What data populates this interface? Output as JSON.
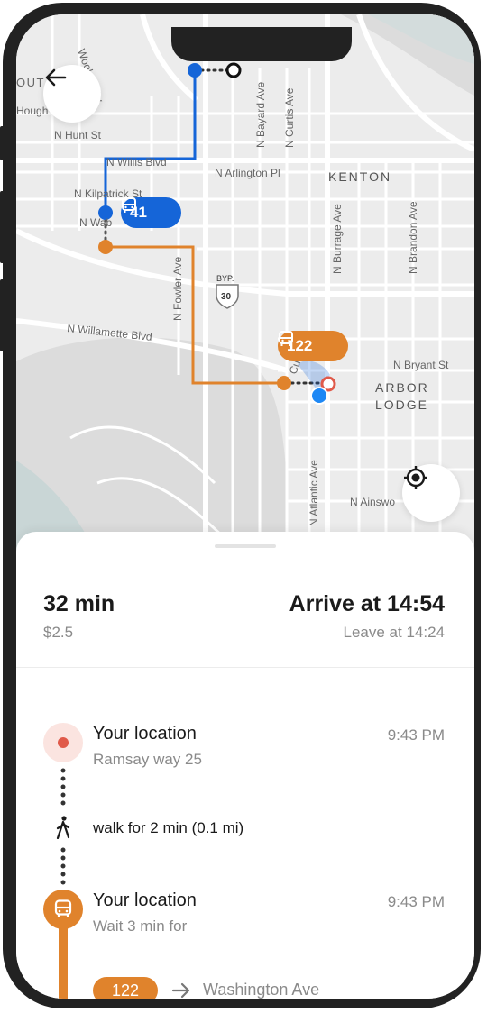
{
  "colors": {
    "bus_blue": "#1565d8",
    "bus_orange": "#e0832c",
    "map_bg": "#ececec",
    "text_primary": "#1a1a1a",
    "text_secondary": "#8a8a8a"
  },
  "map": {
    "street_labels": {
      "woolsey": "Woolsey Av",
      "out": "OUT",
      "hough": "Hough",
      "hunt": "N Hunt St",
      "willis": "N Willis Blvd",
      "arlington": "N Arlington Pl",
      "kenton": "KENTON",
      "bayard": "N Bayard Ave",
      "curtis": "N Curtis Ave",
      "kilpatrick": "N Kilpatrick St",
      "wabash": "N Wab",
      "burrage": "N Burrage Ave",
      "brandon": "N Brandon Ave",
      "fowler": "N Fowler Ave",
      "willamette": "N Willamette Blvd",
      "bryant": "N Bryant St",
      "arbor": "ARBOR",
      "lodge": "LODGE",
      "atlantic": "N Atlantic Ave",
      "ainsworth": "N Ainswo",
      "cu": "Cu",
      "byp": "BYP.",
      "shield_number": "30"
    },
    "bus_routes": [
      {
        "label": "41",
        "color": "#1565d8",
        "icon": "bus-icon"
      },
      {
        "label": "122",
        "color": "#e0832c",
        "icon": "bus-icon"
      }
    ],
    "back_icon": "arrow-left-icon",
    "locate_icon": "crosshair-icon"
  },
  "summary": {
    "duration": "32 min",
    "price": "$2.5",
    "arrive": "Arrive at 14:54",
    "leave": "Leave at 14:24"
  },
  "itinerary": {
    "steps": [
      {
        "title": "Your location",
        "subtitle": "Ramsay way 25",
        "time": "9:43 PM",
        "icon": "location-dot-icon"
      },
      {
        "walk": "walk for 2 min (0.1 mi)",
        "icon": "walking-icon"
      },
      {
        "title": "Your location",
        "subtitle": "Wait 3 min for",
        "time": "9:43 PM",
        "icon": "bus-icon"
      }
    ],
    "route": {
      "number": "122",
      "destination": "Washington Ave",
      "arrow_icon": "arrow-right-icon"
    }
  }
}
